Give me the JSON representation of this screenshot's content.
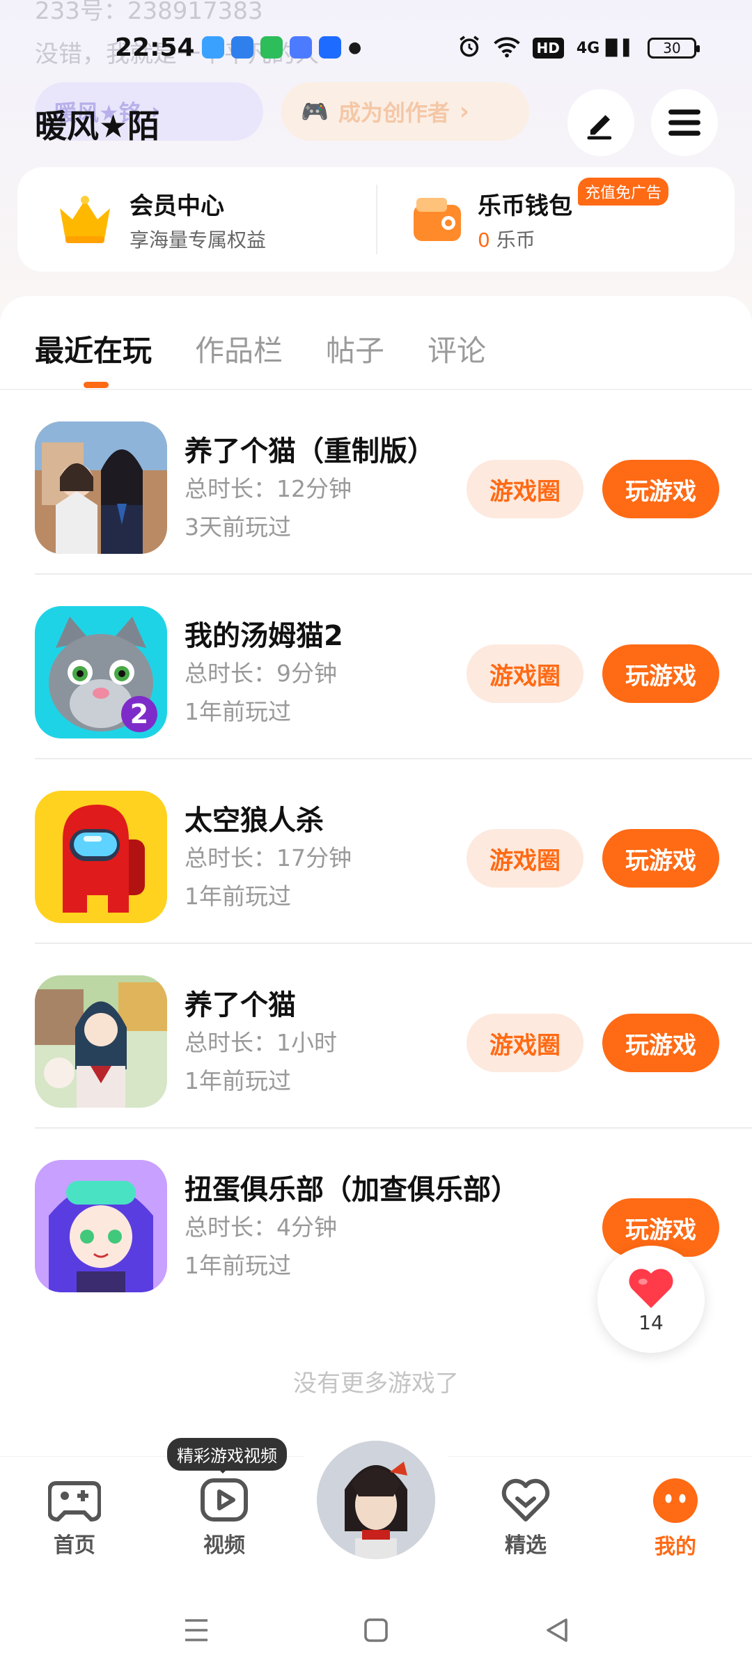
{
  "status_bar": {
    "time": "22:54",
    "network": "4G",
    "hd": "HD",
    "battery": "30"
  },
  "background_profile": {
    "line1": "233号：238917383",
    "line2": "没错，我就是一个平凡的人",
    "pill_name": "暖风★铭",
    "pill_creator": "成为创作者"
  },
  "header": {
    "username": "暖风★陌"
  },
  "member": {
    "title": "会员中心",
    "subtitle": "享海量专属权益"
  },
  "wallet": {
    "title": "乐币钱包",
    "balance": "0",
    "unit": "乐币",
    "tag": "充值免广告"
  },
  "tabs": [
    {
      "label": "最近在玩",
      "active": true
    },
    {
      "label": "作品栏",
      "active": false
    },
    {
      "label": "帖子",
      "active": false
    },
    {
      "label": "评论",
      "active": false
    }
  ],
  "games": [
    {
      "title": "养了个猫（重制版）",
      "duration": "总时长：12分钟",
      "last_played": "3天前玩过",
      "circle_label": "游戏圈",
      "play_label": "玩游戏"
    },
    {
      "title": "我的汤姆猫2",
      "duration": "总时长：9分钟",
      "last_played": "1年前玩过",
      "circle_label": "游戏圈",
      "play_label": "玩游戏"
    },
    {
      "title": "太空狼人杀",
      "duration": "总时长：17分钟",
      "last_played": "1年前玩过",
      "circle_label": "游戏圈",
      "play_label": "玩游戏"
    },
    {
      "title": "养了个猫",
      "duration": "总时长：1小时",
      "last_played": "1年前玩过",
      "circle_label": "游戏圈",
      "play_label": "玩游戏"
    },
    {
      "title": "扭蛋俱乐部（加查俱乐部）",
      "duration": "总时长：4分钟",
      "last_played": "1年前玩过",
      "play_label": "玩游戏"
    }
  ],
  "end_text": "没有更多游戏了",
  "like": {
    "count": "14"
  },
  "bottom_nav": {
    "tooltip": "精彩游戏视频",
    "items": [
      {
        "label": "首页",
        "icon": "gamepad-icon"
      },
      {
        "label": "视频",
        "icon": "play-icon"
      },
      {
        "label": "精选",
        "icon": "heart-check-icon"
      },
      {
        "label": "我的",
        "icon": "face-icon",
        "active": true
      }
    ]
  },
  "colors": {
    "accent": "#ff6a14",
    "accent_light": "#fde9de"
  }
}
